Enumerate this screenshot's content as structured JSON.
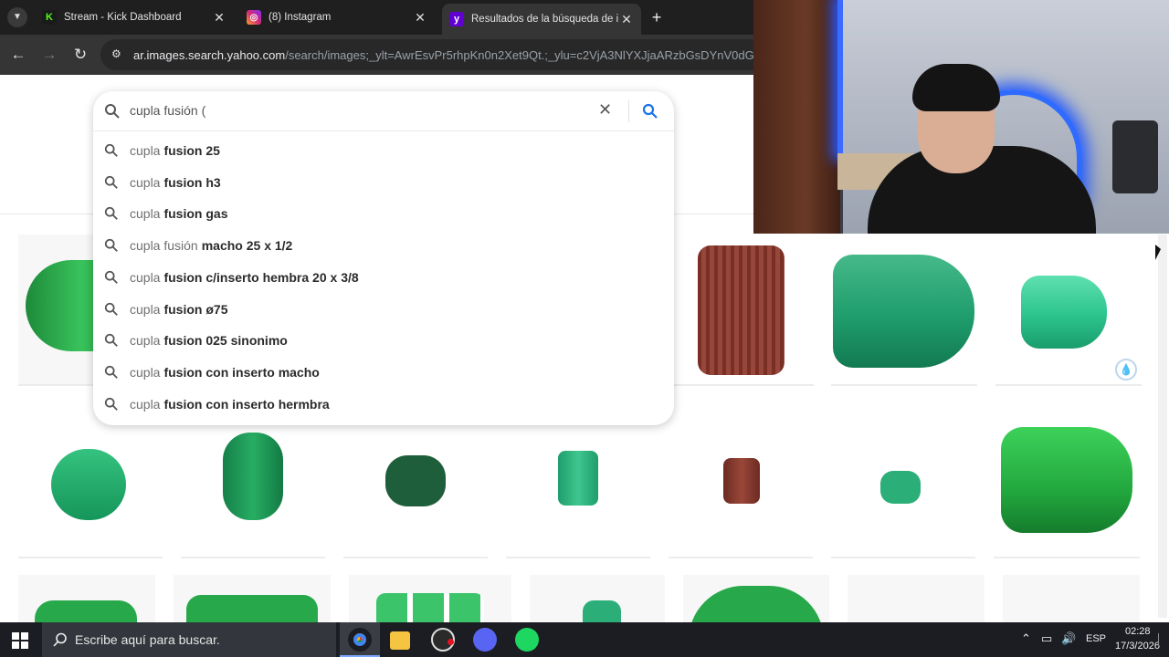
{
  "tabs": [
    {
      "title": "Stream - Kick Dashboard",
      "icon": "kick-icon"
    },
    {
      "title": "(8) Instagram",
      "icon": "instagram-icon"
    },
    {
      "title": "Resultados de la búsqueda de i",
      "icon": "yahoo-icon"
    }
  ],
  "toolbar": {
    "url_host": "ar.images.search.yahoo.com",
    "url_path": "/search/images;_ylt=AwrEsvPr5rhpKn0n2Xet9Qt.;_ylu=c2VjA3NlYXJjaARzbGsDYnV0dG9u;_"
  },
  "search": {
    "query": "cupla fusión (",
    "suggestions": [
      {
        "prefix": "cupla",
        "bold": "fusion 25"
      },
      {
        "prefix": "cupla",
        "bold": "fusion h3"
      },
      {
        "prefix": "cupla",
        "bold": "fusion gas"
      },
      {
        "prefix": "cupla fusión",
        "bold": "macho 25 x 1/2"
      },
      {
        "prefix": "cupla",
        "bold": "fusion c/inserto hembra 20 x 3/8"
      },
      {
        "prefix": "cupla",
        "bold": "fusion ø75"
      },
      {
        "prefix": "cupla",
        "bold": "fusion 025 sinonimo"
      },
      {
        "prefix": "cupla",
        "bold": "fusion con inserto macho"
      },
      {
        "prefix": "cupla",
        "bold": "fusion con inserto hermbra"
      }
    ]
  },
  "taskbar": {
    "search_placeholder": "Escribe aquí para buscar.",
    "language": "ESP",
    "time": "02:28",
    "date": "17/3/2026"
  },
  "colors": {
    "pipe_green": "#27a84a",
    "pipe_teal": "#1f9d6c",
    "pipe_brown": "#8b3a2e",
    "yahoo_purple": "#6001d2",
    "search_blue": "#1a73e8"
  }
}
